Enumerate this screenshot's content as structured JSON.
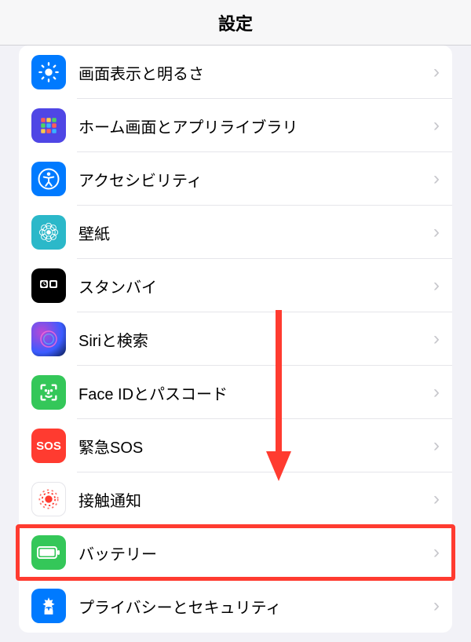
{
  "header": {
    "title": "設定"
  },
  "rows": [
    {
      "label": "画面表示と明るさ",
      "icon": "brightness-icon",
      "bg": "bg-blue"
    },
    {
      "label": "ホーム画面とアプリライブラリ",
      "icon": "home-grid-icon",
      "bg": "bg-indigo"
    },
    {
      "label": "アクセシビリティ",
      "icon": "accessibility-icon",
      "bg": "bg-blue"
    },
    {
      "label": "壁紙",
      "icon": "wallpaper-icon",
      "bg": "bg-teal"
    },
    {
      "label": "スタンバイ",
      "icon": "standby-icon",
      "bg": "bg-black"
    },
    {
      "label": "Siriと検索",
      "icon": "siri-icon",
      "bg": "siri-bg"
    },
    {
      "label": "Face IDとパスコード",
      "icon": "faceid-icon",
      "bg": "bg-green"
    },
    {
      "label": "緊急SOS",
      "icon": "sos-icon",
      "bg": "bg-red",
      "text": "SOS"
    },
    {
      "label": "接触通知",
      "icon": "exposure-icon",
      "bg": "bg-white"
    },
    {
      "label": "バッテリー",
      "icon": "battery-icon",
      "bg": "bg-green",
      "highlighted": true
    },
    {
      "label": "プライバシーとセキュリティ",
      "icon": "privacy-icon",
      "bg": "bg-blue"
    }
  ],
  "annotation": {
    "arrow_color": "#ff3b30",
    "highlight_color": "#ff3b30"
  }
}
